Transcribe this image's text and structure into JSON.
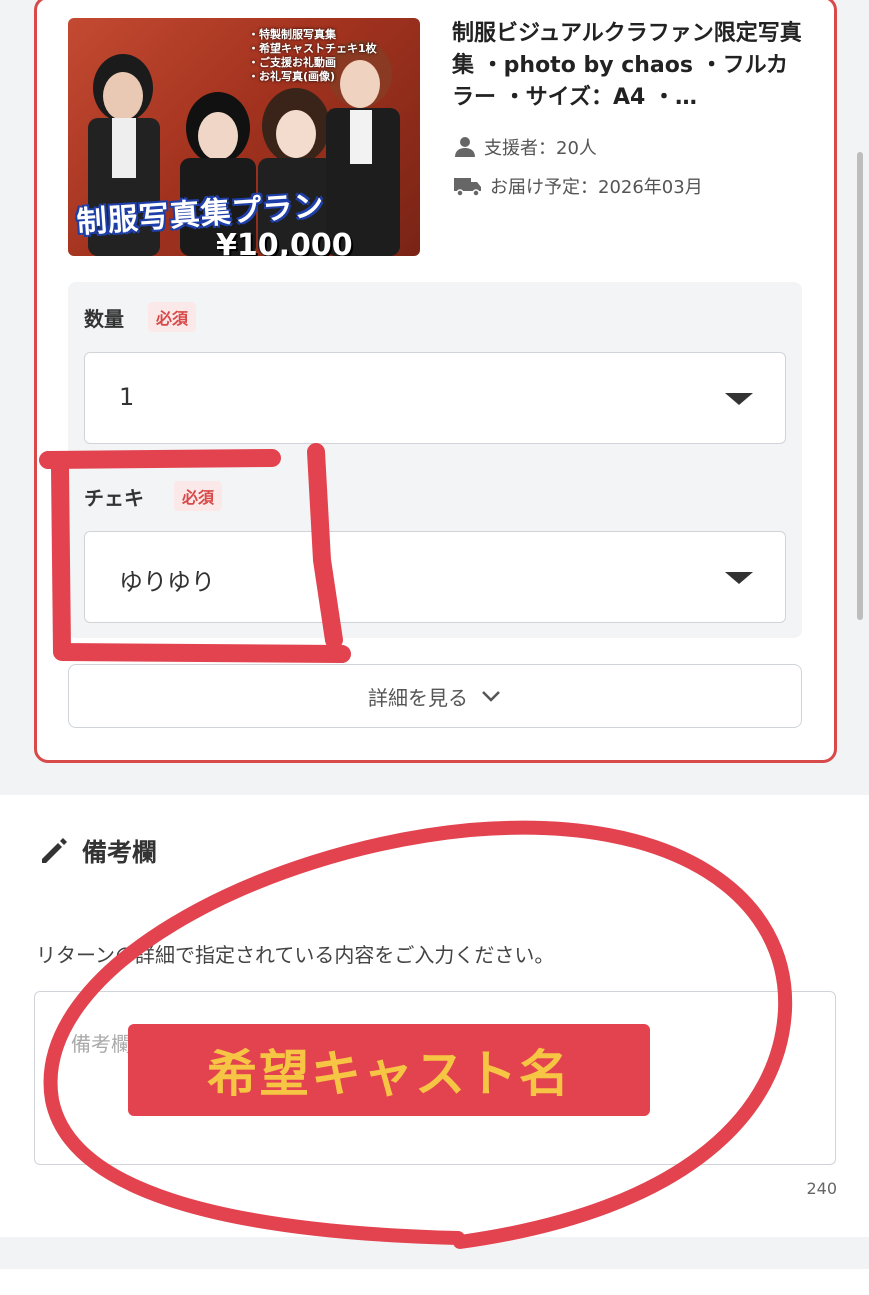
{
  "reward": {
    "title": "制服ビジュアルクラファン限定写真集 ・photo by chaos ・フルカラー ・サイズ：A4 ・…",
    "supporters": "支援者：20人",
    "delivery": "お届け予定：2026年03月",
    "image": {
      "bullets": [
        "・特製制服写真集",
        "・希望キャストチェキ1枚",
        "・ご支援お礼動画",
        "・お礼写真(画像)"
      ],
      "banner": "制服写真集プラン",
      "price": "¥10,000"
    }
  },
  "form": {
    "quantity": {
      "label": "数量",
      "required": "必須",
      "value": "1"
    },
    "cheki": {
      "label": "チェキ",
      "required": "必須",
      "value": "ゆりゆり"
    },
    "details_button": "詳細を見る"
  },
  "remarks": {
    "title": "備考欄",
    "description": "リターンの詳細で指定されている内容をご入力ください。",
    "placeholder": "備考欄にご入力ください",
    "char_count": "240"
  },
  "annotation": {
    "banner_text": "希望キャスト名",
    "color": "#e2434f",
    "text_color": "#f6c544"
  }
}
